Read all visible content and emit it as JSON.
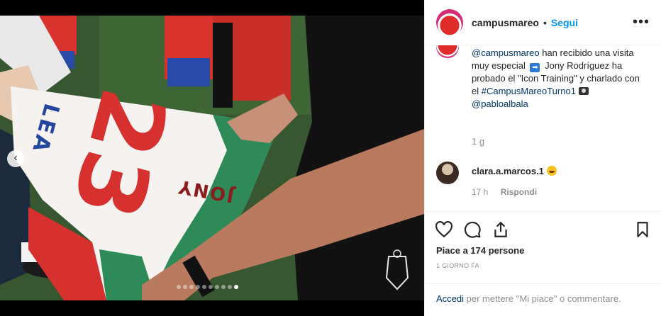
{
  "header": {
    "username": "campusmareo",
    "separator": "•",
    "follow_label": "Segui",
    "more_icon": "more-options-icon"
  },
  "caption": {
    "mention_1": "@campusmareo",
    "text_1": " han recibido una visita muy especial ",
    "arrow_icon": "arrow-right-icon",
    "text_2": " Jony Rodríguez ha probado el \"Icon Training\" y charlado con el ",
    "hashtag": "#CampusMareoTurno1",
    "camera_icon": "camera-icon",
    "mention_2": "@pabloalbala",
    "time": "1 g"
  },
  "comment": {
    "user": "clara.a.marcos.1",
    "emoji": "grinning-face-icon",
    "time": "17 h",
    "reply_label": "Rispondi"
  },
  "actions": {
    "like_icon": "heart-icon",
    "comment_icon": "comment-icon",
    "share_icon": "share-icon",
    "save_icon": "bookmark-icon"
  },
  "likes_text": "Piace a 174 persone",
  "posted_ago": "1 GIORNO FA",
  "login": {
    "link": "Accedi",
    "rest": " per mettere \"Mi piace\" o commentare."
  },
  "photo": {
    "jersey_number": "23",
    "jersey_name": "JONY",
    "jersey_text_top": "LEA",
    "carousel_total": 10,
    "carousel_active": 10
  },
  "colors": {
    "accent": "#0095f6",
    "link": "#00376b",
    "muted": "#8e8e8e",
    "jersey_red": "#d6302f",
    "jersey_green": "#2e8b57"
  }
}
